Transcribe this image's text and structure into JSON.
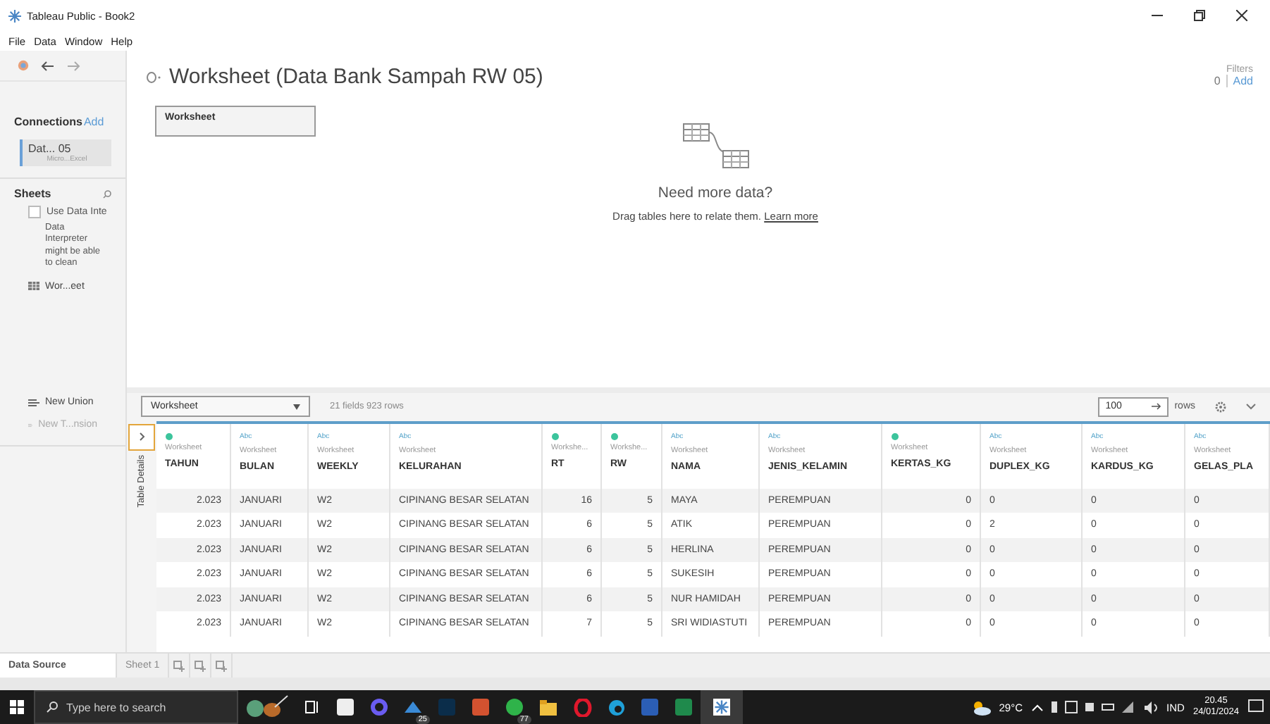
{
  "window": {
    "title": "Tableau Public - Book2"
  },
  "menu": [
    "File",
    "Data",
    "Window",
    "Help"
  ],
  "sidebar": {
    "connections_label": "Connections",
    "connections_add": "Add",
    "connection": {
      "name": "Dat... 05",
      "type": "Micro...Excel",
      "selected": true
    },
    "sheets_label": "Sheets",
    "interpreter": {
      "label": "Use Data Inte",
      "checked": false,
      "note": "Data Interpreter might be able to clean"
    },
    "sheets": [
      {
        "name": "Wor...eet"
      }
    ],
    "actions": [
      {
        "label": "New Union",
        "disabled": false
      },
      {
        "label": "New T...nsion",
        "disabled": true
      }
    ]
  },
  "header": {
    "title": "Worksheet (Data Bank Sampah RW 05)",
    "filters_label": "Filters",
    "filters_count": "0",
    "filters_add": "Add"
  },
  "canvas": {
    "table_card": "Worksheet",
    "prompt": "Need more data?",
    "hint": "Drag tables here to relate them.",
    "link": "Learn more"
  },
  "grid_toolbar": {
    "table_select": "Worksheet",
    "summary": "21 fields 923 rows",
    "rows_input": "100",
    "rows_label": "rows"
  },
  "table_details": "Table Details",
  "columns": [
    {
      "kind": "number",
      "source": "Worksheet",
      "name": "TAHUN"
    },
    {
      "kind": "string",
      "type_label": "Abc",
      "source": "Worksheet",
      "name": "BULAN"
    },
    {
      "kind": "string",
      "type_label": "Abc",
      "source": "Worksheet",
      "name": "WEEKLY"
    },
    {
      "kind": "string",
      "type_label": "Abc",
      "source": "Worksheet",
      "name": "KELURAHAN"
    },
    {
      "kind": "number",
      "source": "Workshe...",
      "name": "RT"
    },
    {
      "kind": "number",
      "source": "Workshe...",
      "name": "RW"
    },
    {
      "kind": "string",
      "type_label": "Abc",
      "source": "Worksheet",
      "name": "NAMA"
    },
    {
      "kind": "string",
      "type_label": "Abc",
      "source": "Worksheet",
      "name": "JENIS_KELAMIN"
    },
    {
      "kind": "number",
      "source": "Worksheet",
      "name": "KERTAS_KG"
    },
    {
      "kind": "string",
      "type_label": "Abc",
      "source": "Worksheet",
      "name": "DUPLEX_KG"
    },
    {
      "kind": "string",
      "type_label": "Abc",
      "source": "Worksheet",
      "name": "KARDUS_KG"
    },
    {
      "kind": "string",
      "type_label": "Abc",
      "source": "Worksheet",
      "name": "GELAS_PLA"
    }
  ],
  "rows": [
    [
      "2.023",
      "JANUARI",
      "W2",
      "CIPINANG BESAR SELATAN",
      "16",
      "5",
      "MAYA",
      "PEREMPUAN",
      "0",
      "0",
      "0",
      "0"
    ],
    [
      "2.023",
      "JANUARI",
      "W2",
      "CIPINANG BESAR SELATAN",
      "6",
      "5",
      "ATIK",
      "PEREMPUAN",
      "0",
      "2",
      "0",
      "0"
    ],
    [
      "2.023",
      "JANUARI",
      "W2",
      "CIPINANG BESAR SELATAN",
      "6",
      "5",
      "HERLINA",
      "PEREMPUAN",
      "0",
      "0",
      "0",
      "0"
    ],
    [
      "2.023",
      "JANUARI",
      "W2",
      "CIPINANG BESAR SELATAN",
      "6",
      "5",
      "SUKESIH",
      "PEREMPUAN",
      "0",
      "0",
      "0",
      "0"
    ],
    [
      "2.023",
      "JANUARI",
      "W2",
      "CIPINANG BESAR SELATAN",
      "6",
      "5",
      "NUR HAMIDAH",
      "PEREMPUAN",
      "0",
      "0",
      "0",
      "0"
    ],
    [
      "2.023",
      "JANUARI",
      "W2",
      "CIPINANG BESAR SELATAN",
      "7",
      "5",
      "SRI WIDIASTUTI",
      "PEREMPUAN",
      "0",
      "0",
      "0",
      "0"
    ]
  ],
  "bottom_tabs": [
    {
      "label": "Data Source",
      "selected": true
    },
    {
      "label": "Sheet 1",
      "selected": false
    }
  ],
  "taskbar": {
    "search_placeholder": "Type here to search",
    "mail_badge": "25",
    "chat_badge": "77",
    "temperature": "29°C",
    "language": "IND",
    "time": "20.45",
    "date": "24/01/2024"
  }
}
